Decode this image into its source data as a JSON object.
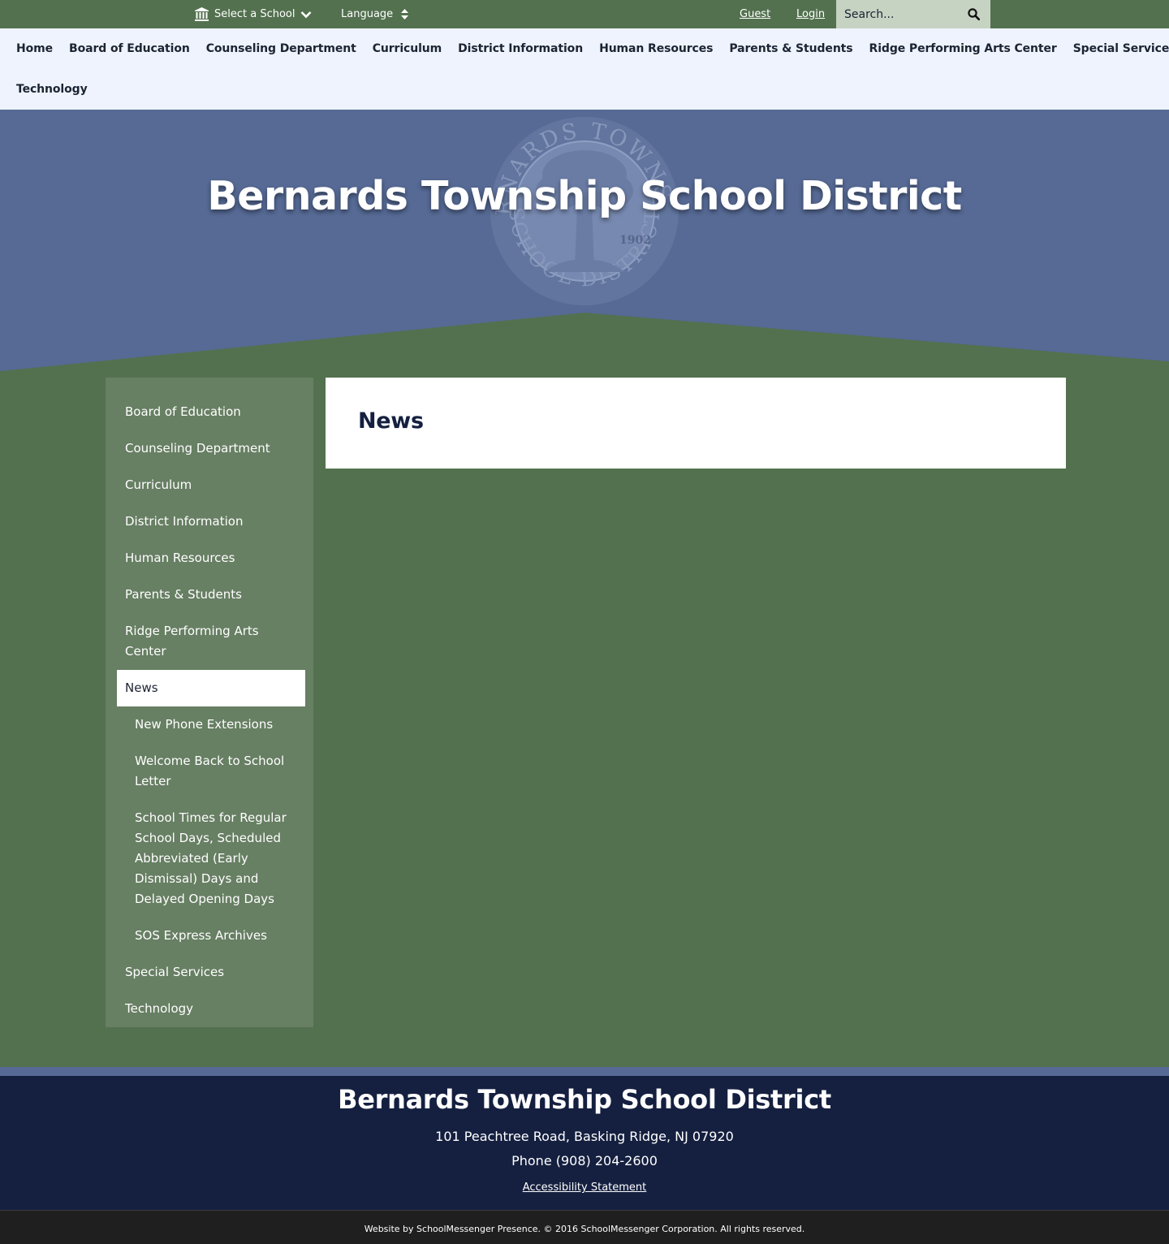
{
  "topbar": {
    "school_select_label": "Select a School",
    "language_label": "Language",
    "guest_label": "Guest",
    "login_label": "Login",
    "search_placeholder": "Search..."
  },
  "mainnav": {
    "items": [
      {
        "label": "Home"
      },
      {
        "label": "Board of Education"
      },
      {
        "label": "Counseling Department"
      },
      {
        "label": "Curriculum"
      },
      {
        "label": "District Information"
      },
      {
        "label": "Human Resources"
      },
      {
        "label": "Parents & Students"
      },
      {
        "label": "Ridge Performing Arts Center"
      },
      {
        "label": "Special Services"
      },
      {
        "label": "Technology"
      }
    ]
  },
  "banner": {
    "title": "Bernards Township School District",
    "seal_text_top": "BERNARDS TOWNSHIP",
    "seal_text_bottom": "SCHOOL DISTRICT",
    "seal_year": "1902"
  },
  "sidebar": {
    "items": [
      {
        "label": "Board of Education"
      },
      {
        "label": "Counseling Department"
      },
      {
        "label": "Curriculum"
      },
      {
        "label": "District Information"
      },
      {
        "label": "Human Resources"
      },
      {
        "label": "Parents & Students"
      },
      {
        "label": "Ridge Performing Arts Center"
      },
      {
        "label": "News"
      },
      {
        "label": "New Phone Extensions"
      },
      {
        "label": "Welcome Back to School Letter"
      },
      {
        "label": "School Times for Regular School Days, Scheduled Abbreviated (Early Dismissal) Days and Delayed Opening Days"
      },
      {
        "label": "SOS Express Archives"
      },
      {
        "label": "Special Services"
      },
      {
        "label": "Technology"
      }
    ]
  },
  "content": {
    "heading": "News"
  },
  "footer": {
    "name": "Bernards Township School District",
    "address": "101 Peachtree Road, Basking Ridge, NJ 07920",
    "phone": "Phone (908) 204-2600",
    "accessibility_label": "Accessibility Statement",
    "copyright": "Website by SchoolMessenger Presence. © 2016 SchoolMessenger Corporation. All rights reserved."
  },
  "colors": {
    "green": "#53714f",
    "blue": "#566a95",
    "navy": "#152040",
    "nav_bg": "#eef3fd"
  }
}
